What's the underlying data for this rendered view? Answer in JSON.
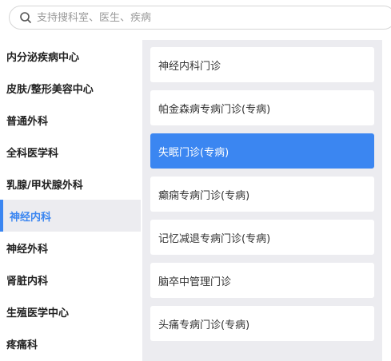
{
  "search": {
    "placeholder": "支持搜科室、医生、疾病",
    "value": ""
  },
  "sidebar": {
    "items": [
      {
        "label": "内分泌疾病中心"
      },
      {
        "label": "皮肤/整形美容中心"
      },
      {
        "label": "普通外科"
      },
      {
        "label": "全科医学科"
      },
      {
        "label": "乳腺/甲状腺外科"
      },
      {
        "label": "神经内科",
        "active": true
      },
      {
        "label": "神经外科"
      },
      {
        "label": "肾脏内科"
      },
      {
        "label": "生殖医学中心"
      },
      {
        "label": "疼痛科"
      }
    ]
  },
  "clinics": {
    "items": [
      {
        "label": "神经内科门诊"
      },
      {
        "label": "帕金森病专病门诊(专病)"
      },
      {
        "label": "失眠门诊(专病)",
        "selected": true
      },
      {
        "label": "癫痫专病门诊(专病)"
      },
      {
        "label": "记忆减退专病门诊(专病)"
      },
      {
        "label": "脑卒中管理门诊"
      },
      {
        "label": "头痛专病门诊(专病)"
      }
    ]
  },
  "colors": {
    "accent": "#3b86f1",
    "panel_bg": "#ececf0"
  }
}
